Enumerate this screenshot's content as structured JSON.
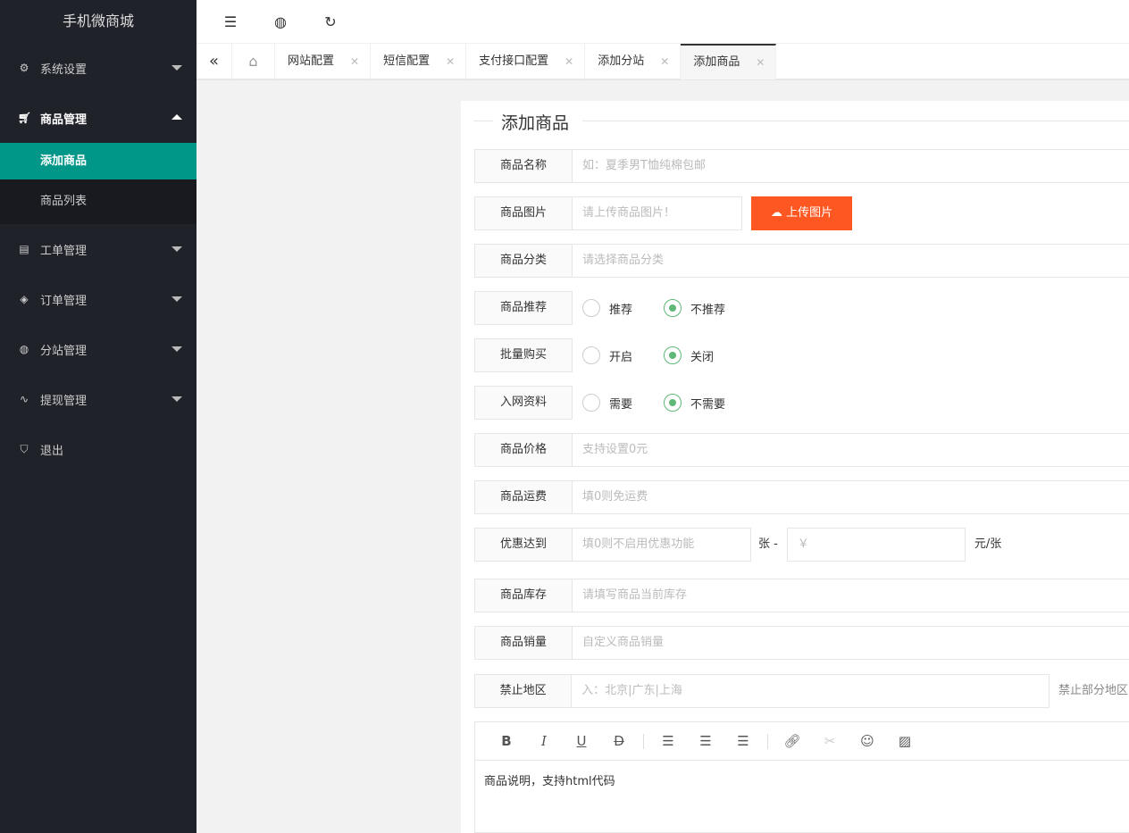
{
  "app": {
    "title": "手机微商城"
  },
  "sidebar": {
    "items": [
      {
        "label": "系统设置",
        "icon": "gear-icon"
      },
      {
        "label": "商品管理",
        "icon": "cart-icon"
      },
      {
        "label": "工单管理",
        "icon": "ticket-icon"
      },
      {
        "label": "订单管理",
        "icon": "layers-icon"
      },
      {
        "label": "分站管理",
        "icon": "globe-icon"
      },
      {
        "label": "提现管理",
        "icon": "pulse-icon"
      },
      {
        "label": "退出",
        "icon": "shield-icon"
      }
    ],
    "sub": [
      "添加商品",
      "商品列表"
    ]
  },
  "tabs": [
    "网站配置",
    "短信配置",
    "支付接口配置",
    "添加分站",
    "添加商品"
  ],
  "form": {
    "title": "添加商品",
    "name": {
      "label": "商品名称",
      "placeholder": "如：夏季男T恤纯棉包邮"
    },
    "image": {
      "label": "商品图片",
      "placeholder": "请上传商品图片！",
      "button": "上传图片"
    },
    "category": {
      "label": "商品分类",
      "placeholder": "请选择商品分类"
    },
    "recommend": {
      "label": "商品推荐",
      "options": [
        "推荐",
        "不推荐"
      ],
      "selected": "不推荐"
    },
    "bulk": {
      "label": "批量购买",
      "options": [
        "开启",
        "关闭"
      ],
      "selected": "关闭"
    },
    "netinfo": {
      "label": "入网资料",
      "options": [
        "需要",
        "不需要"
      ],
      "selected": "不需要"
    },
    "price": {
      "label": "商品价格",
      "placeholder": "支持设置0元"
    },
    "shipping": {
      "label": "商品运费",
      "placeholder": "填0则免运费"
    },
    "discount": {
      "label": "优惠达到",
      "placeholder": "填0则不启用优惠功能",
      "unit1": "张 -",
      "price_placeholder": "￥",
      "unit2": "元/张"
    },
    "stock": {
      "label": "商品库存",
      "placeholder": "请填写商品当前库存"
    },
    "sales": {
      "label": "商品销量",
      "placeholder": "自定义商品销量"
    },
    "region": {
      "label": "禁止地区",
      "placeholder": "入：北京|广东|上海",
      "hint": "禁止部分地区"
    },
    "editor": {
      "content": "商品说明，支持html代码"
    }
  }
}
